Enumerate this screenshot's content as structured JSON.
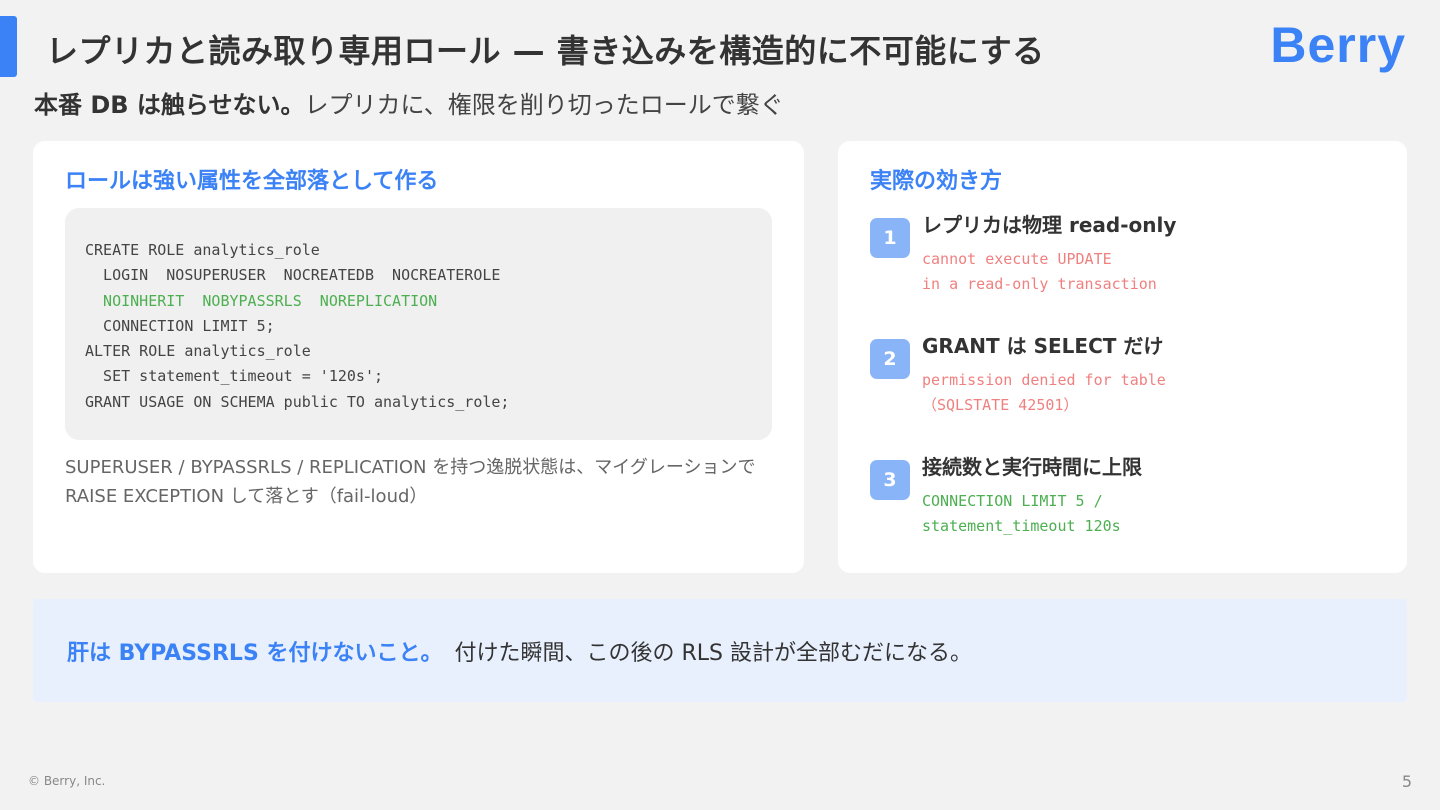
{
  "header": {
    "title": "レプリカと読み取り専用ロール — 書き込みを構造的に不可能にする",
    "logo": "Berry",
    "subtitle_strong": "本番 DB は触らせない。",
    "subtitle_normal": "レプリカに、権限を削り切ったロールで繋ぐ"
  },
  "left_card": {
    "heading": "ロールは強い属性を全部落として作る",
    "code_lines": [
      {
        "text": "CREATE ROLE analytics_role",
        "highlight": false
      },
      {
        "text": "  LOGIN  NOSUPERUSER  NOCREATEDB  NOCREATEROLE",
        "highlight": false
      },
      {
        "text": "  NOINHERIT  NOBYPASSRLS  NOREPLICATION",
        "highlight": true
      },
      {
        "text": "  CONNECTION LIMIT 5;",
        "highlight": false
      },
      {
        "text": "ALTER ROLE analytics_role",
        "highlight": false
      },
      {
        "text": "  SET statement_timeout = '120s';",
        "highlight": false
      },
      {
        "text": "GRANT USAGE ON SCHEMA public TO analytics_role;",
        "highlight": false
      }
    ],
    "note": "SUPERUSER / BYPASSRLS / REPLICATION を持つ逸脱状態は、マイグレーションで RAISE EXCEPTION して落とす（fail-loud）"
  },
  "right_card": {
    "heading": "実際の効き方",
    "steps": [
      {
        "number": "1",
        "title": "レプリカは物理  read-only",
        "code": "cannot execute UPDATE\nin a read-only transaction",
        "code_color": "red"
      },
      {
        "number": "2",
        "title": "GRANT は SELECT だけ",
        "code": "permission denied for table\n（SQLSTATE 42501）",
        "code_color": "red"
      },
      {
        "number": "3",
        "title": "接続数と実行時間に上限",
        "code": "CONNECTION LIMIT 5 /\nstatement_timeout 120s",
        "code_color": "green"
      }
    ]
  },
  "callout": {
    "strong": "肝は BYPASSRLS を付けないこと。",
    "normal": "付けた瞬間、この後の  RLS 設計が全部むだになる。"
  },
  "footer": {
    "copyright": "© Berry, Inc.",
    "page_number": "5"
  },
  "colors": {
    "accent": "#3b82f6",
    "step_badge": "#8ab4f8",
    "code_green": "#4caf50",
    "code_red": "#f08080",
    "callout_bg": "#e8f0fd"
  }
}
